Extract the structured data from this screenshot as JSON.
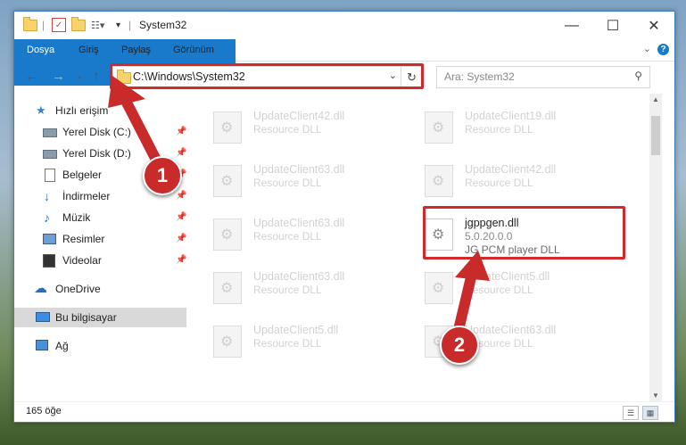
{
  "window": {
    "title": "System32"
  },
  "ribbon": {
    "tabs": [
      "Dosya",
      "Giriş",
      "Paylaş",
      "Görünüm"
    ],
    "help": "?"
  },
  "address": {
    "path": "C:\\Windows\\System32"
  },
  "search": {
    "placeholder": "Ara: System32"
  },
  "sidebar": {
    "items": [
      {
        "label": "Hızlı erişim",
        "icon": "star-icon"
      },
      {
        "label": "Yerel Disk (C:)",
        "icon": "drive-icon",
        "pinned": true
      },
      {
        "label": "Yerel Disk (D:)",
        "icon": "drive-icon",
        "pinned": true
      },
      {
        "label": "Belgeler",
        "icon": "document-icon",
        "pinned": true
      },
      {
        "label": "İndirmeler",
        "icon": "download-icon",
        "pinned": true
      },
      {
        "label": "Müzik",
        "icon": "music-icon",
        "pinned": true
      },
      {
        "label": "Resimler",
        "icon": "pictures-icon",
        "pinned": true
      },
      {
        "label": "Videolar",
        "icon": "video-icon",
        "pinned": true
      },
      {
        "label": "OneDrive",
        "icon": "cloud-icon"
      },
      {
        "label": "Bu bilgisayar",
        "icon": "computer-icon",
        "selected": true
      },
      {
        "label": "Ağ",
        "icon": "network-icon"
      }
    ]
  },
  "files": [
    {
      "name": "UpdateClient42.dll",
      "desc": "Resource DLL"
    },
    {
      "name": "UpdateClient19.dll",
      "desc": "Resource DLL"
    },
    {
      "name": "UpdateClient63.dll",
      "desc": "Resource DLL"
    },
    {
      "name": "UpdateClient42.dll",
      "desc": "Resource DLL"
    },
    {
      "name": "UpdateClient63.dll",
      "desc": "Resource DLL"
    },
    {
      "name": "jgppgen.dll",
      "version": "5.0.20.0.0",
      "desc": "JG PCM player DLL",
      "highlighted": true
    },
    {
      "name": "UpdateClient63.dll",
      "desc": "Resource DLL"
    },
    {
      "name": "UpdateClient5.dll",
      "desc": "Resource DLL"
    },
    {
      "name": "UpdateClient5.dll",
      "desc": "Resource DLL"
    },
    {
      "name": "UpdateClient63.dll",
      "desc": "Resource DLL"
    }
  ],
  "status": {
    "count": "165 öğe"
  },
  "annotations": {
    "step1": "1",
    "step2": "2"
  },
  "colors": {
    "accent": "#1979ca",
    "highlight": "#d22a2a",
    "badge": "#c92a2a"
  }
}
